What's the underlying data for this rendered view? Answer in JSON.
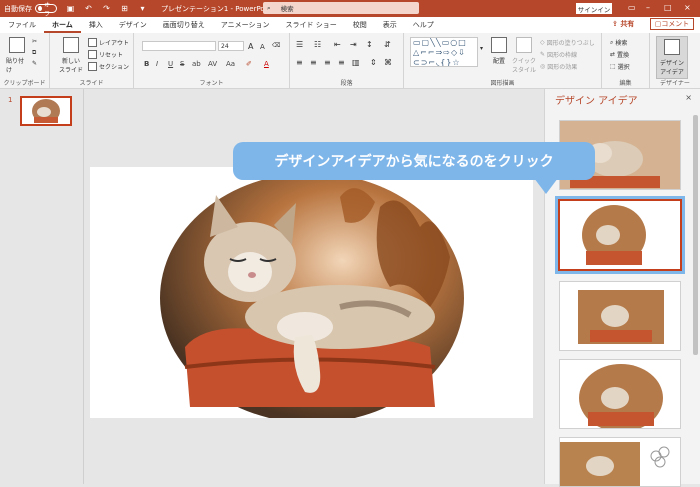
{
  "titlebar": {
    "autosave_label": "自動保存",
    "autosave_state": "オフ",
    "doc_title": "プレゼンテーション1 - PowerPo...",
    "search_label": "検索",
    "signin_label": "サインイン"
  },
  "tabs": [
    "ファイル",
    "ホーム",
    "挿入",
    "デザイン",
    "画面切り替え",
    "アニメーション",
    "スライド ショー",
    "校閲",
    "表示",
    "ヘルプ"
  ],
  "share_label": "共有",
  "comment_label": "コメント",
  "ribbon": {
    "clipboard": {
      "paste": "貼り付け",
      "label": "クリップボード"
    },
    "slides": {
      "new_slide": "新しい\nスライド",
      "layout": "レイアウト",
      "reset": "リセット",
      "section": "セクション",
      "label": "スライド"
    },
    "font": {
      "font_size": "24",
      "label": "フォント",
      "bold": "B",
      "italic": "I",
      "underline": "U",
      "strike": "S",
      "shadow": "ab",
      "spacing": "AV",
      "case": "Aa"
    },
    "paragraph": {
      "label": "段落"
    },
    "drawing": {
      "arrange": "配置",
      "quick_styles": "クイック\nスタイル",
      "fill": "図形の塗りつぶし",
      "outline": "図形の枠線",
      "effects": "図形の効果",
      "label": "図形描画"
    },
    "editing": {
      "find": "検索",
      "replace": "置換",
      "select": "選択",
      "label": "編集"
    },
    "designer": {
      "button": "デザイン\nアイデア",
      "label": "デザイナー"
    }
  },
  "slide_number": "1",
  "callout_text": "デザインアイデアから気になるのをクリック",
  "design_pane": {
    "title": "デザイン アイデア",
    "close": "×"
  },
  "colors": {
    "accent": "#b7472a",
    "callout": "#7fb6ea",
    "selection": "#c43e1c"
  }
}
